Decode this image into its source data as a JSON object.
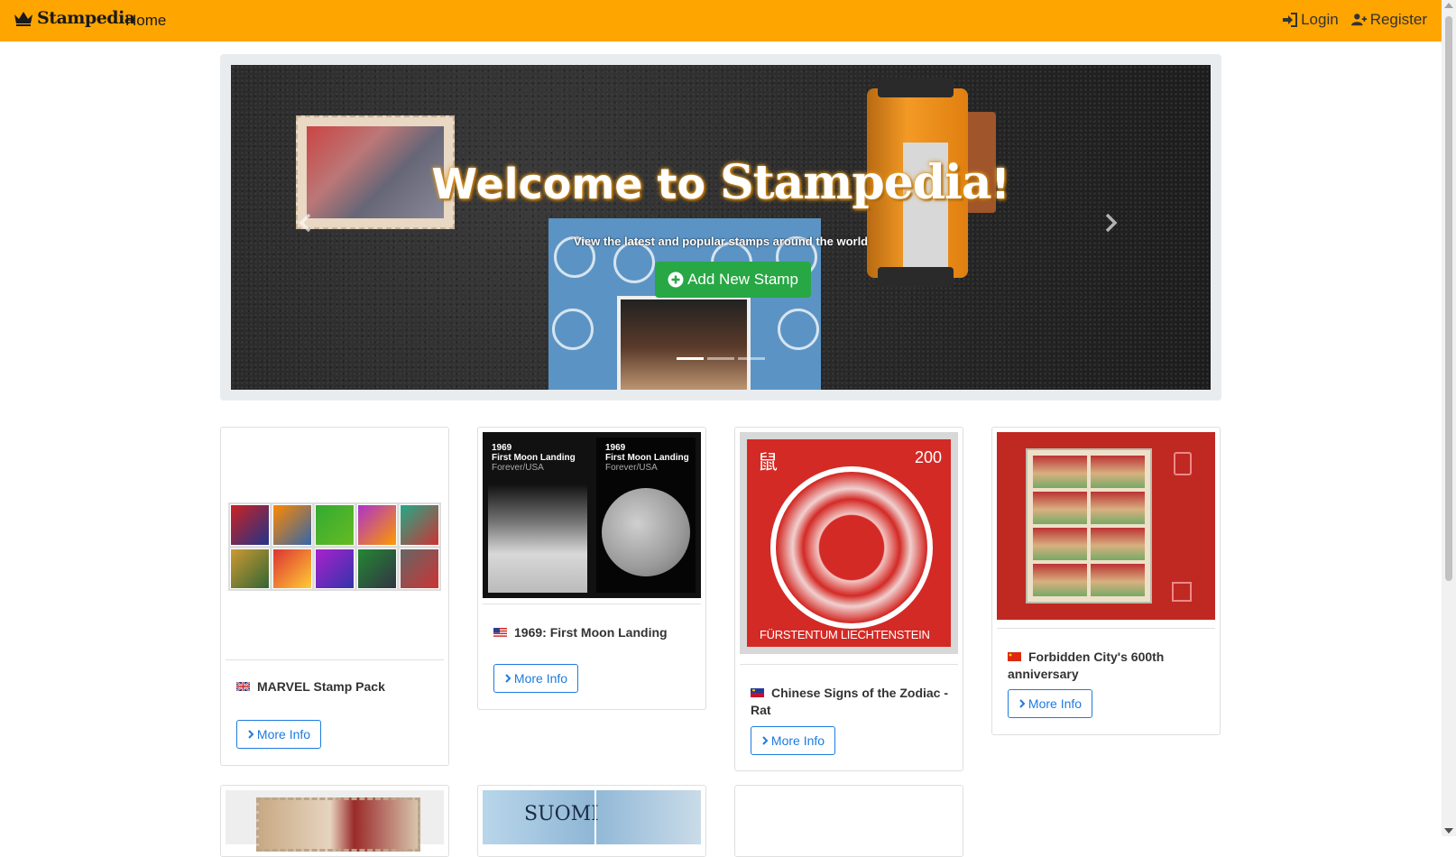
{
  "navbar": {
    "brand": "Stampedia",
    "home": "Home",
    "login": "Login",
    "register": "Register",
    "background": "#ffa500"
  },
  "hero": {
    "title_prefix": "Welcome to",
    "title_brand": "Stampedia",
    "title_suffix": "!",
    "subtitle": "View the latest and popular stamps around the world",
    "add_button": "Add New Stamp",
    "slide_count": 3,
    "active_slide": 1
  },
  "cards": [
    {
      "title": "MARVEL Stamp Pack",
      "country_flag": "uk-flag-icon",
      "button": "More Info"
    },
    {
      "title": "1969: First Moon Landing",
      "country_flag": "us-flag-icon",
      "button": "More Info",
      "stamp_text": {
        "year": "1969",
        "line": "First Moon Landing",
        "brand": "Forever/USA"
      }
    },
    {
      "title": "Chinese Signs of the Zodiac - Rat",
      "country_flag": "liechtenstein-flag-icon",
      "button": "More Info",
      "stamp_text": {
        "value": "200",
        "country": "FÜRSTENTUM LIECHTENSTEIN",
        "glyph": "鼠"
      }
    },
    {
      "title": "Forbidden City's 600th anniversary",
      "country_flag": "china-flag-icon",
      "button": "More Info"
    }
  ],
  "partial_cards": [
    {
      "image": "portrait-stamps"
    },
    {
      "image": "suomi-stamps",
      "stamp_text": "SUOMI"
    },
    {
      "image": "blank"
    }
  ],
  "colors": {
    "accent": "#ffa500",
    "success": "#28a745",
    "primary": "#1d7be0"
  }
}
